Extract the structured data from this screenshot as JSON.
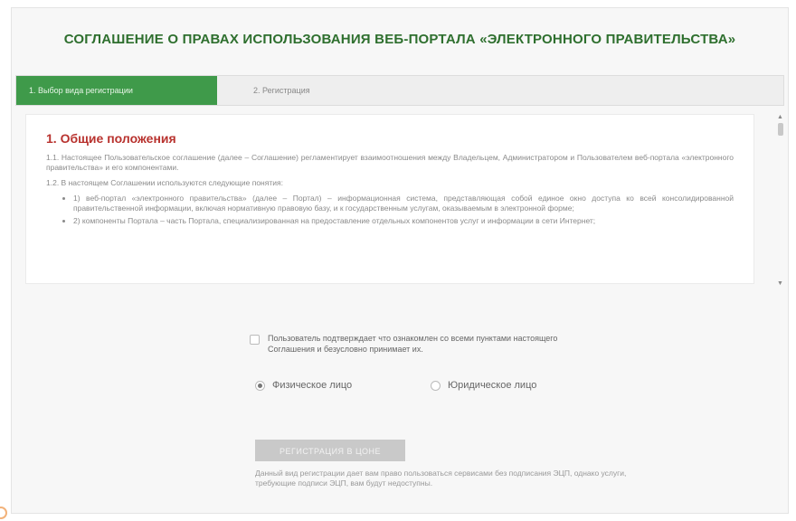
{
  "page": {
    "title": "СОГЛАШЕНИЕ О ПРАВАХ ИСПОЛЬЗОВАНИЯ ВЕБ-ПОРТАЛА «ЭЛЕКТРОННОГО ПРАВИТЕЛЬСТВА»"
  },
  "steps": [
    {
      "label": "1. Выбор вида регистрации",
      "active": true
    },
    {
      "label": "2. Регистрация",
      "active": false
    }
  ],
  "agreement": {
    "section_title": "1. Общие положения",
    "p1": "1.1. Настоящее Пользовательское соглашение (далее – Соглашение) регламентирует взаимоотношения между Владельцем, Администратором и Пользователем веб-портала «электронного правительства» и его компонентами.",
    "p2": "1.2. В настоящем Соглашении используются следующие понятия:",
    "definitions": [
      "1) веб-портал «электронного правительства» (далее – Портал) – информационная система, представляющая собой единое окно доступа ко всей консолидированной правительственной информации, включая нормативную правовую базу, и к государственным услугам, оказываемым в электронной форме;",
      "2) компоненты Портала – часть Портала, специализированная на предоставление отдельных компонентов услуг и информации в сети Интернет;"
    ]
  },
  "form": {
    "confirm_text": "Пользователь подтверждает что ознакомлен со всеми пунктами настоящего Соглашения и безусловно принимает их.",
    "confirm_checked": false,
    "radio_individual": "Физическое лицо",
    "radio_legal": "Юридическое лицо",
    "selected": "individual",
    "submit_label": "РЕГИСТРАЦИЯ В ЦОНЕ",
    "note": "Данный вид регистрации дает вам право пользоваться сервисами без подписания ЭЦП, однако услуги, требующие подписи ЭЦП, вам будут недоступны."
  },
  "colors": {
    "accent": "#3f9a4a",
    "title": "#2e6f2e",
    "section_title": "#b8322e"
  }
}
